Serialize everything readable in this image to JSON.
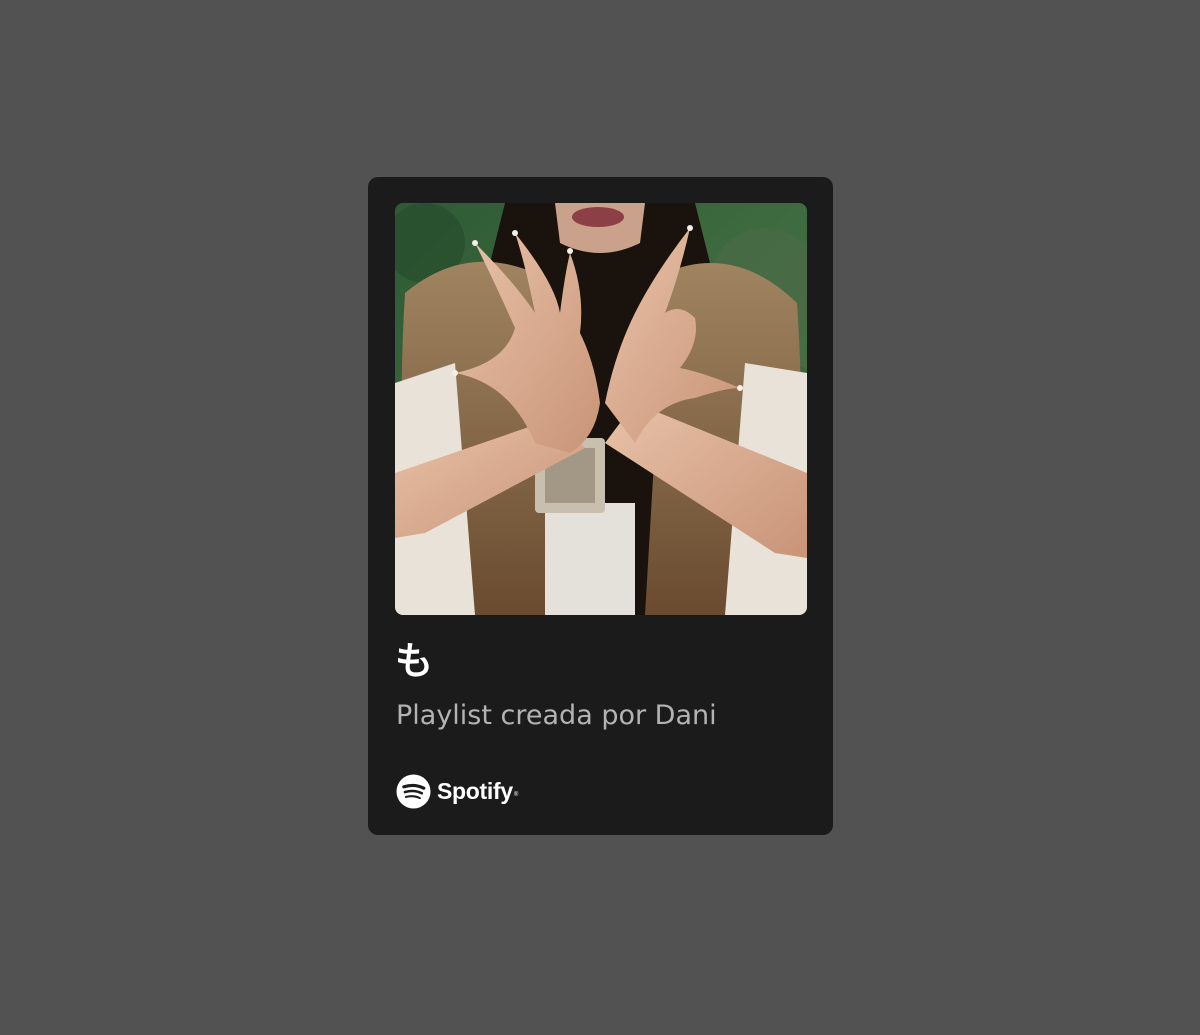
{
  "card": {
    "cover_image": "playlist-cover-photo",
    "title": "も",
    "subtitle": "Playlist creada por Dani"
  },
  "brand": {
    "icon": "spotify-logo-icon",
    "name": "Spotify",
    "registered_mark": "®"
  },
  "colors": {
    "page_background": "#525252",
    "card_background": "#1b1b1b",
    "title_text": "#ffffff",
    "subtitle_text": "#b3b3b3"
  }
}
